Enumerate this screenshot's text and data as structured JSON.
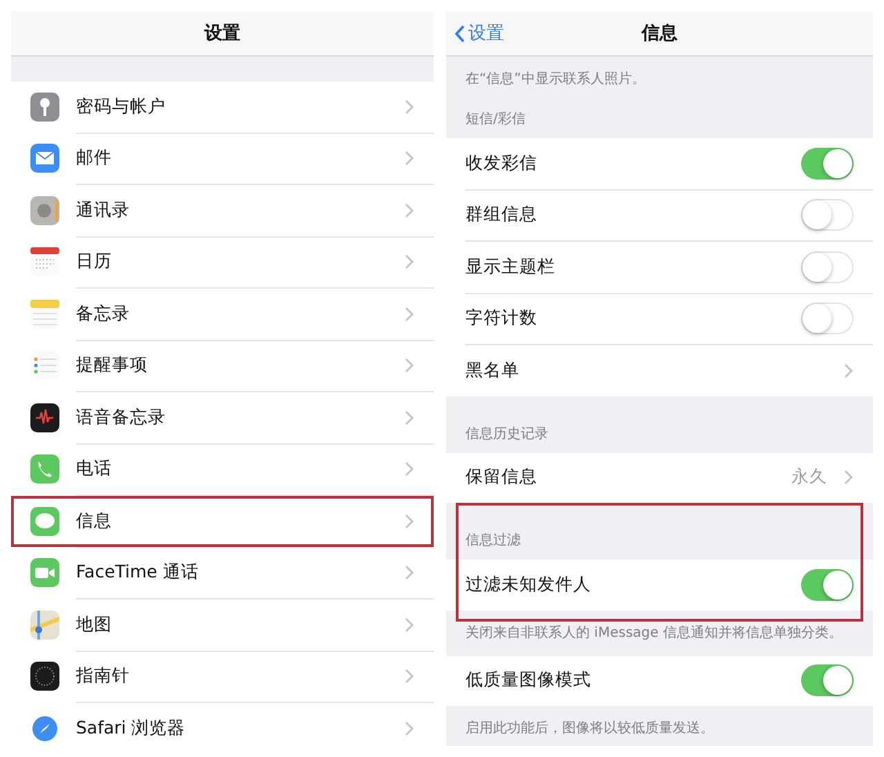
{
  "settings_panel": {
    "title": "设置",
    "items": [
      {
        "label": "密码与帐户",
        "highlighted": false
      },
      {
        "label": "邮件",
        "highlighted": false
      },
      {
        "label": "通讯录",
        "highlighted": false
      },
      {
        "label": "日历",
        "highlighted": false
      },
      {
        "label": "备忘录",
        "highlighted": false
      },
      {
        "label": "提醒事项",
        "highlighted": false
      },
      {
        "label": "语音备忘录",
        "highlighted": false
      },
      {
        "label": "电话",
        "highlighted": false
      },
      {
        "label": "信息",
        "highlighted": true
      },
      {
        "label": "FaceTime 通话",
        "highlighted": false
      },
      {
        "label": "地图",
        "highlighted": false
      },
      {
        "label": "指南针",
        "highlighted": false
      },
      {
        "label": "Safari 浏览器",
        "highlighted": false
      }
    ]
  },
  "messages_panel": {
    "back": "设置",
    "title": "信息",
    "sections": [
      {
        "footer": "在“信息”中显示联系人照片。"
      },
      {
        "header": "短信/彩信",
        "highlighted": false,
        "rows": [
          {
            "kind": "toggle",
            "label": "收发彩信",
            "on": true
          },
          {
            "kind": "toggle",
            "label": "群组信息",
            "on": false
          },
          {
            "kind": "toggle",
            "label": "显示主题栏",
            "on": false
          },
          {
            "kind": "toggle",
            "label": "字符计数",
            "on": false
          },
          {
            "kind": "link",
            "label": "黑名单"
          }
        ]
      },
      {
        "header": "信息历史记录",
        "highlighted": false,
        "rows": [
          {
            "kind": "link",
            "label": "保留信息",
            "value": "永久"
          }
        ]
      },
      {
        "header": "信息过滤",
        "highlighted": true,
        "rows": [
          {
            "kind": "toggle",
            "label": "过滤未知发件人",
            "on": true
          }
        ],
        "footer": "关闭来自非联系人的 iMessage 信息通知并将信息单独分类。"
      },
      {
        "highlighted": false,
        "rows": [
          {
            "kind": "toggle",
            "label": "低质量图像模式",
            "on": true
          }
        ],
        "footer": "启用此功能后，图像将以较低质量发送。"
      }
    ]
  }
}
